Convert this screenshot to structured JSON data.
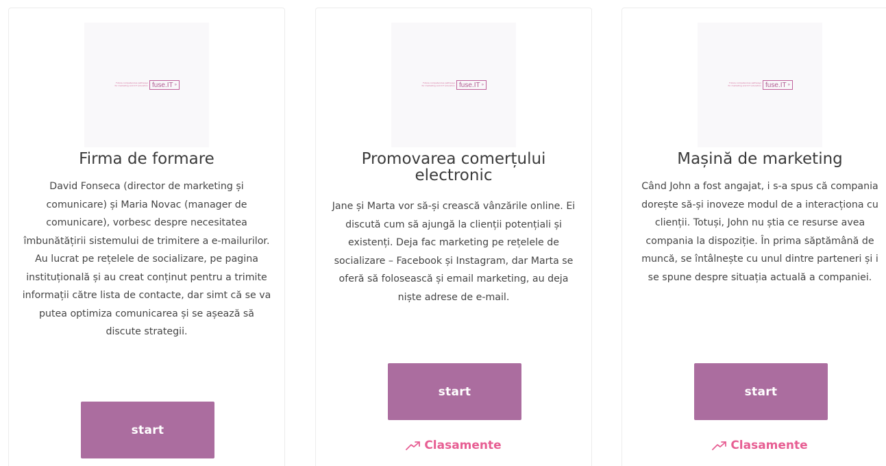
{
  "cards": [
    {
      "logo_tagline": "Future competencies pathways for marketing and ICT education",
      "logo_text": "fuse.IT",
      "logo_arrow": "»",
      "title": "Firma de formare",
      "description": "David Fonseca (director de marketing și comunicare) și Maria Novac (manager de comunicare), vorbesc despre necesitatea îmbunătățirii sistemului de trimitere a e-mailurilor. Au lucrat pe rețelele de socializare, pe pagina instituțională și au creat conținut pentru a trimite informații către lista de contacte, dar simt că se va putea optimiza comunicarea și se așează să discute strategii.",
      "start_label": "start"
    },
    {
      "logo_tagline": "Future competencies pathways for marketing and ICT education",
      "logo_text": "fuse.IT",
      "logo_arrow": "»",
      "title": "Promovarea comerțului electronic",
      "description": "Jane și Marta vor să-și crească vânzările online. Ei discută cum să ajungă la clienții potențiali și existenți. Deja fac marketing pe rețelele de socializare – Facebook și Instagram, dar Marta se oferă să folosească și email marketing, au deja niște adrese de e-mail.",
      "start_label": "start",
      "rankings_label": "Clasamente"
    },
    {
      "logo_tagline": "Future competencies pathways for marketing and ICT education",
      "logo_text": "fuse.IT",
      "logo_arrow": "»",
      "title": "Mașină de marketing",
      "description": "Când John a fost angajat, i s-a spus că compania dorește să-și inoveze modul de a interacționa cu clienții. Totuși, John nu știa ce resurse avea compania la dispoziție. În prima săptămână de muncă, se întâlnește cu unul dintre parteneri și i se spune despre situația actuală a companiei.",
      "start_label": "start",
      "rankings_label": "Clasamente"
    }
  ],
  "colors": {
    "button_bg": "#ab6d9f",
    "button_text": "#ffffff",
    "link": "#e75e93",
    "logo": "#b05a90"
  },
  "icons": {
    "rankings": "trending-up-icon"
  }
}
